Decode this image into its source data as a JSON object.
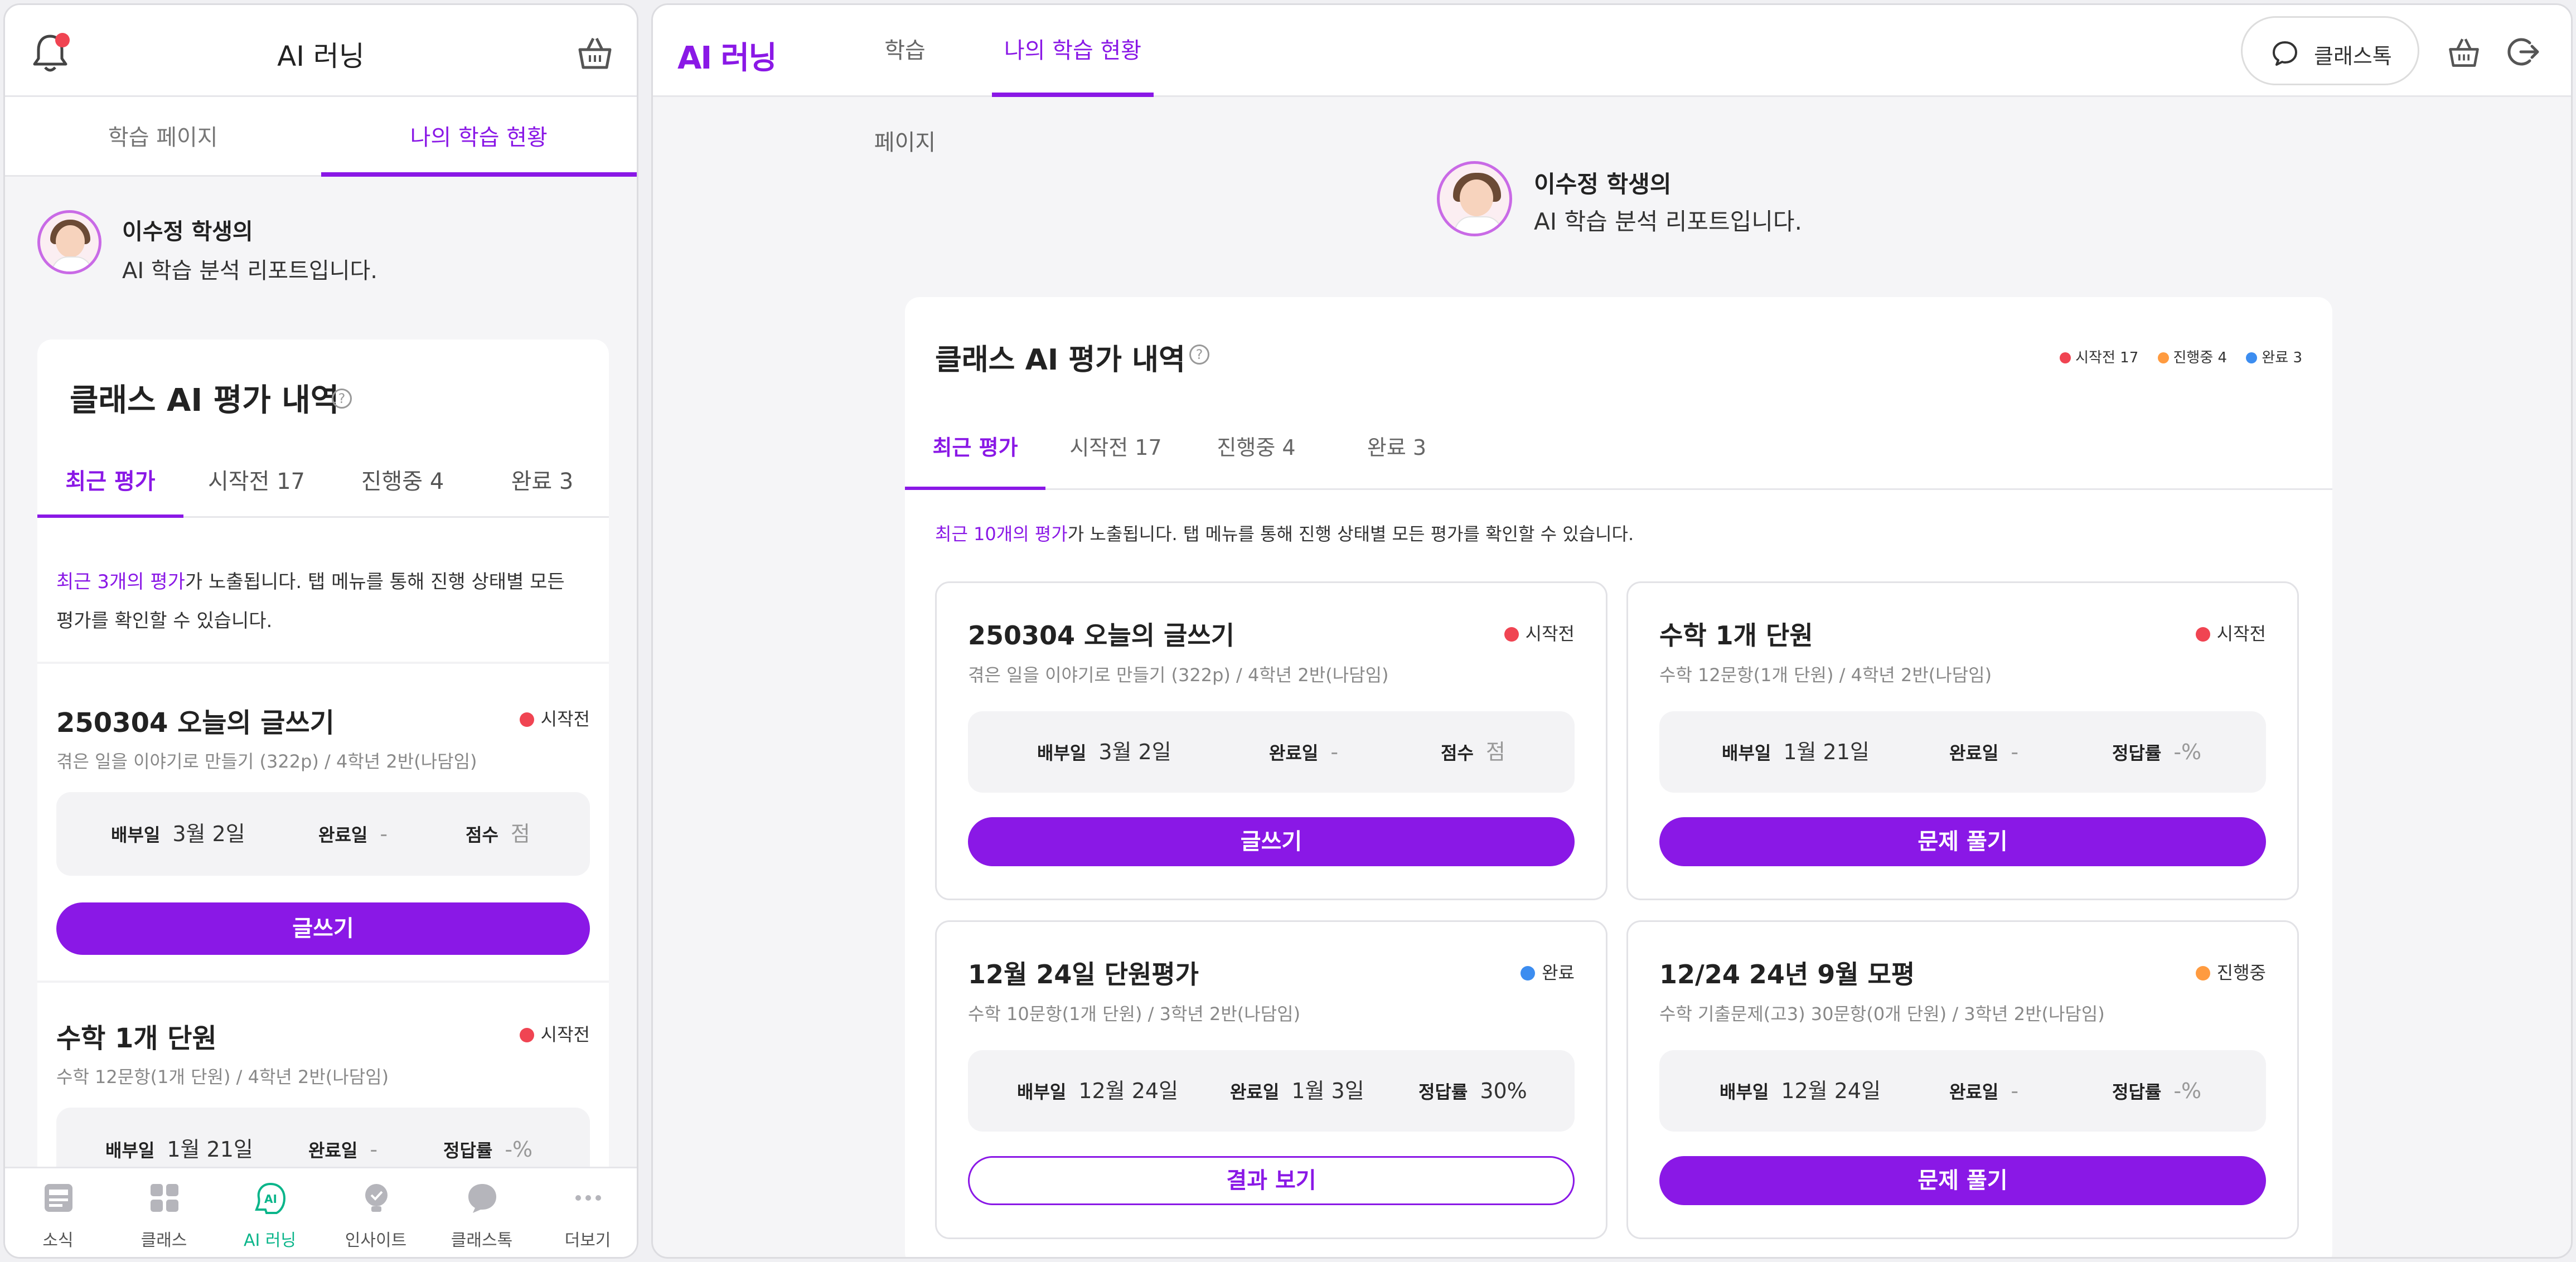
{
  "app_title": "AI 러닝",
  "logo": "AI 러닝",
  "nav_tabs": [
    "학습 페이지",
    "나의 학습 현황"
  ],
  "intro": {
    "name_line": "이수정 학생의",
    "sub_line": "AI 학습 분석 리포트입니다."
  },
  "section": {
    "title": "클래스 AI 평가 내역",
    "help": "?",
    "tabs": [
      "최근 평가",
      "시작전 17",
      "진행중 4",
      "완료 3"
    ],
    "legend": [
      {
        "label": "시작전 17",
        "color": "#f04452"
      },
      {
        "label": "진행중 4",
        "color": "#ff9b40"
      },
      {
        "label": "완료 3",
        "color": "#3c8df0"
      }
    ]
  },
  "mobile_notice": {
    "highlight": "최근 3개의 평가",
    "rest_line1": "가 노출됩니다. 탭 메뉴를 통해 진행 상태별 모든",
    "rest_line2": "평가를 확인할 수 있습니다."
  },
  "desktop_notice": {
    "highlight": "최근 10개의 평가",
    "rest": "가 노출됩니다. 탭 메뉴를 통해 진행 상태별 모든 평가를 확인할 수 있습니다."
  },
  "evaluations": [
    {
      "title": "250304 오늘의 글쓰기",
      "subtitle": "겪은 일을 이야기로 만들기 (322p) / 4학년 2반(나담임)",
      "status": "시작전",
      "status_color": "#f04452",
      "assigned_label": "배부일",
      "assigned": "3월 2일",
      "completed_label": "완료일",
      "completed": "-",
      "score_label": "점수",
      "score": "점",
      "button": "글쓰기",
      "button_style": "filled"
    },
    {
      "title": "수학 1개 단원",
      "subtitle": "수학 12문항(1개 단원) / 4학년 2반(나담임)",
      "status": "시작전",
      "status_color": "#f04452",
      "assigned_label": "배부일",
      "assigned": "1월 21일",
      "completed_label": "완료일",
      "completed": "-",
      "score_label": "정답률",
      "score": "-%",
      "button": "문제 풀기",
      "button_style": "filled"
    },
    {
      "title": "12월 24일 단원평가",
      "subtitle": "수학 10문항(1개 단원) / 3학년 2반(나담임)",
      "status": "완료",
      "status_color": "#3c8df0",
      "assigned_label": "배부일",
      "assigned": "12월 24일",
      "completed_label": "완료일",
      "completed": "1월 3일",
      "score_label": "정답률",
      "score": "30%",
      "button": "결과 보기",
      "button_style": "outline"
    },
    {
      "title": "12/24 24년 9월 모평",
      "subtitle": "수학 기출문제(고3) 30문항(0개 단원) / 3학년 2반(나담임)",
      "status": "진행중",
      "status_color": "#ff9b40",
      "assigned_label": "배부일",
      "assigned": "12월 24일",
      "completed_label": "완료일",
      "completed": "-",
      "score_label": "정답률",
      "score": "-%",
      "button": "문제 풀기",
      "button_style": "filled"
    }
  ],
  "bottom_nav": [
    {
      "label": "소식",
      "icon": "news-icon"
    },
    {
      "label": "클래스",
      "icon": "grid-icon"
    },
    {
      "label": "AI 러닝",
      "icon": "ai-learning-icon",
      "active": true
    },
    {
      "label": "인사이트",
      "icon": "insight-icon"
    },
    {
      "label": "클래스톡",
      "icon": "chat-icon"
    },
    {
      "label": "더보기",
      "icon": "more-icon"
    }
  ],
  "header_actions": {
    "classtalk": "클래스톡"
  },
  "colors": {
    "accent": "#8a18e6",
    "nav_active": "#0ab58a"
  }
}
